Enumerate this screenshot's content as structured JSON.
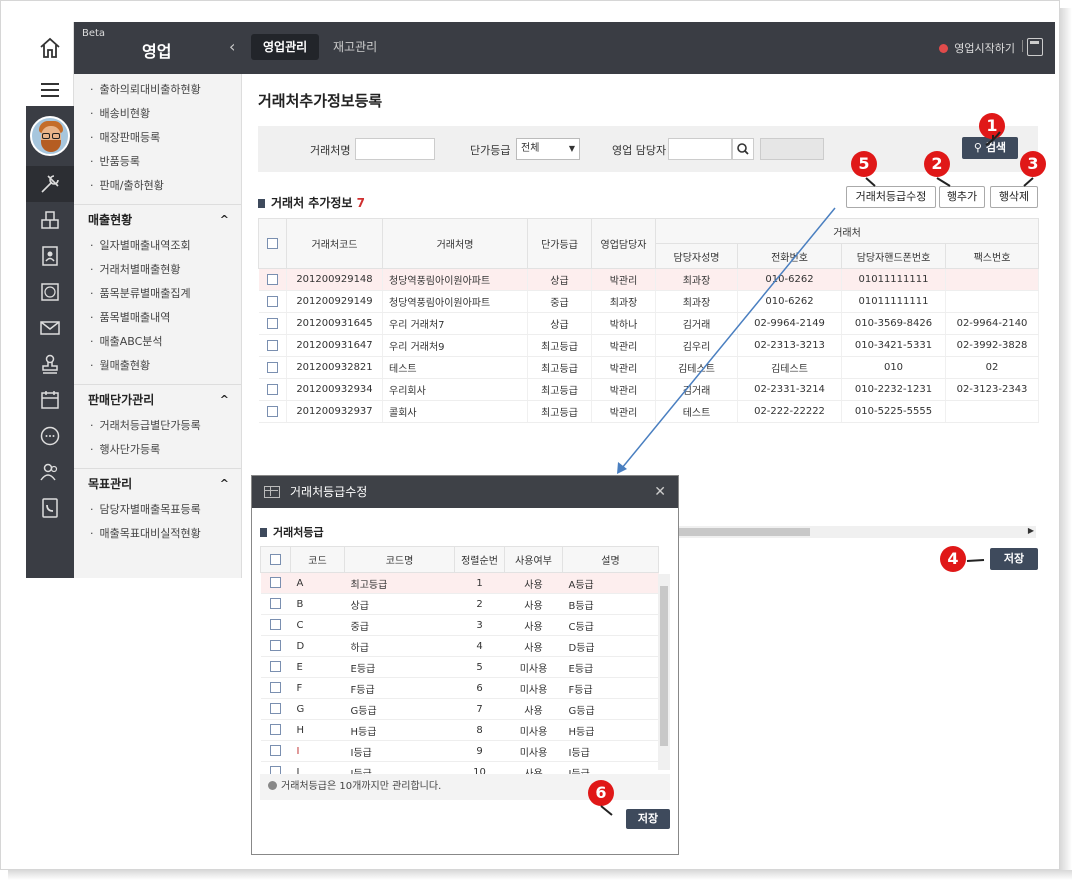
{
  "app": {
    "beta": "Beta",
    "title": "영업",
    "start_label": "영업시작하기"
  },
  "top_tabs": [
    {
      "label": "영업관리"
    },
    {
      "label": "재고관리"
    }
  ],
  "side_menu": {
    "items_a": [
      "출하의뢰대비출하현황",
      "배송비현황",
      "매장판매등록",
      "반품등록",
      "판매/출하현황"
    ],
    "group_b": "매출현황",
    "items_b": [
      "일자별매출내역조회",
      "거래처별매출현황",
      "품목분류별매출집계",
      "품목별매출내역",
      "매출ABC분석",
      "월매출현황"
    ],
    "group_c": "판매단가관리",
    "items_c": [
      "거래처등급별단가등록",
      "행사단가등록"
    ],
    "group_d": "목표관리",
    "items_d": [
      "담당자별매출목표등록",
      "매출목표대비실적현황"
    ]
  },
  "page": {
    "title": "거래처추가정보등록",
    "filter": {
      "client_label": "거래처명",
      "grade_label": "단가등급",
      "grade_value": "전체",
      "manager_label": "영업 담당자",
      "search_label": "검색"
    },
    "section_title": "거래처 추가정보",
    "section_count": "7",
    "buttons": {
      "grade_edit": "거래처등급수정",
      "add_row": "행추가",
      "del_row": "행삭제",
      "save": "저장"
    },
    "columns": {
      "code": "거래처코드",
      "name": "거래처명",
      "grade": "단가등급",
      "sales": "영업담당자",
      "group": "거래처",
      "contact": "담당자성명",
      "phone": "전화번호",
      "mobile": "담당자핸드폰번호",
      "fax": "팩스번호"
    },
    "rows": [
      {
        "code": "201200929148",
        "name": "청당역풍림아이원아파트",
        "grade": "상급",
        "sales": "박관리",
        "contact": "최과장",
        "phone": "010-6262",
        "mobile": "01011111111",
        "fax": ""
      },
      {
        "code": "201200929149",
        "name": "청당역풍림아이원아파트",
        "grade": "중급",
        "sales": "최과장",
        "contact": "최과장",
        "phone": "010-6262",
        "mobile": "01011111111",
        "fax": ""
      },
      {
        "code": "201200931645",
        "name": "우리 거래처7",
        "grade": "상급",
        "sales": "박하나",
        "contact": "김거래",
        "phone": "02-9964-2149",
        "mobile": "010-3569-8426",
        "fax": "02-9964-2140"
      },
      {
        "code": "201200931647",
        "name": "우리 거래처9",
        "grade": "최고등급",
        "sales": "박관리",
        "contact": "김우리",
        "phone": "02-2313-3213",
        "mobile": "010-3421-5331",
        "fax": "02-3992-3828"
      },
      {
        "code": "201200932821",
        "name": "테스트",
        "grade": "최고등급",
        "sales": "박관리",
        "contact": "김테스트",
        "phone": "김테스트",
        "mobile": "010",
        "fax": "02"
      },
      {
        "code": "201200932934",
        "name": "우리회사",
        "grade": "최고등급",
        "sales": "박관리",
        "contact": "김거래",
        "phone": "02-2331-3214",
        "mobile": "010-2232-1231",
        "fax": "02-3123-2343"
      },
      {
        "code": "201200932937",
        "name": "콜회사",
        "grade": "최고등급",
        "sales": "박관리",
        "contact": "테스트",
        "phone": "02-222-22222",
        "mobile": "010-5225-5555",
        "fax": ""
      }
    ]
  },
  "dialog": {
    "title": "거래처등급수정",
    "section": "거래처등급",
    "columns": {
      "code": "코드",
      "name": "코드명",
      "order": "정렬순번",
      "use": "사용여부",
      "desc": "설명"
    },
    "rows": [
      {
        "code": "A",
        "name": "최고등급",
        "order": "1",
        "use": "사용",
        "desc": "A등급"
      },
      {
        "code": "B",
        "name": "상급",
        "order": "2",
        "use": "사용",
        "desc": "B등급"
      },
      {
        "code": "C",
        "name": "중급",
        "order": "3",
        "use": "사용",
        "desc": "C등급"
      },
      {
        "code": "D",
        "name": "하급",
        "order": "4",
        "use": "사용",
        "desc": "D등급"
      },
      {
        "code": "E",
        "name": "E등급",
        "order": "5",
        "use": "미사용",
        "desc": "E등급"
      },
      {
        "code": "F",
        "name": "F등급",
        "order": "6",
        "use": "미사용",
        "desc": "F등급"
      },
      {
        "code": "G",
        "name": "G등급",
        "order": "7",
        "use": "사용",
        "desc": "G등급"
      },
      {
        "code": "H",
        "name": "H등급",
        "order": "8",
        "use": "미사용",
        "desc": "H등급"
      },
      {
        "code": "I",
        "name": "I등급",
        "order": "9",
        "use": "미사용",
        "desc": "I등급"
      },
      {
        "code": "J",
        "name": "J등급",
        "order": "10",
        "use": "사용",
        "desc": "J등급"
      }
    ],
    "note": "거래처등급은 10개까지만 관리합니다.",
    "save": "저장"
  },
  "callouts": [
    "1",
    "2",
    "3",
    "4",
    "5",
    "6"
  ],
  "colors": {
    "accent": "#e01818",
    "dark_bar": "#3a3d44",
    "button": "#3e4a5c",
    "selected_row": "#fdeeee"
  }
}
